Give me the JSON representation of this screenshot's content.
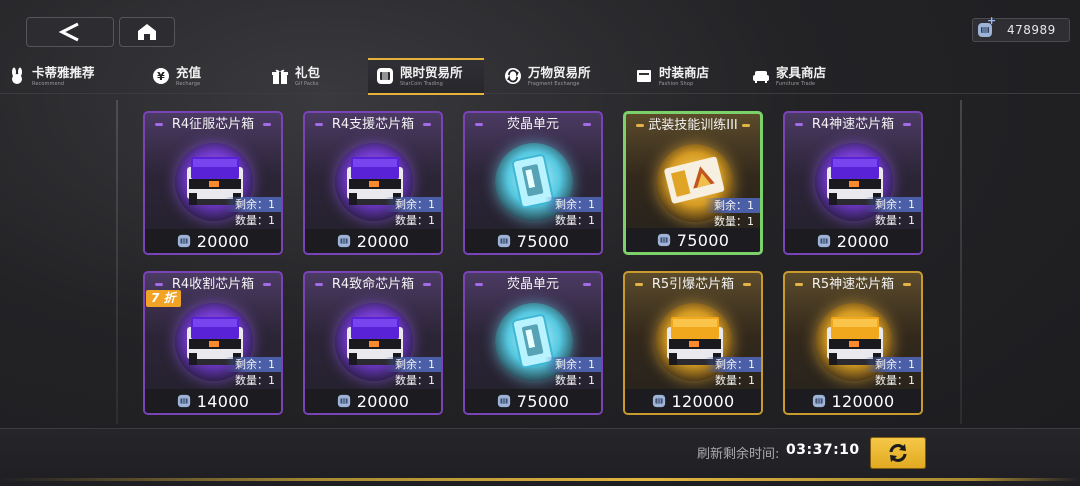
{
  "currency": {
    "amount": "478989"
  },
  "tabs": [
    {
      "label": "卡蒂雅推荐",
      "sub": "Recommend",
      "icon": "bunny-icon"
    },
    {
      "label": "充值",
      "sub": "Recharge",
      "icon": "yen-icon"
    },
    {
      "label": "礼包",
      "sub": "Gif Packs",
      "icon": "gift-icon"
    },
    {
      "label": "限时贸易所",
      "sub": "StarCoin Trading",
      "icon": "trade-icon",
      "active": true
    },
    {
      "label": "万物贸易所",
      "sub": "Fragment Exchange",
      "icon": "exchange-icon"
    },
    {
      "label": "时装商店",
      "sub": "Fashion Shop",
      "icon": "fashion-icon"
    },
    {
      "label": "家具商店",
      "sub": "Furniture Trade",
      "icon": "sofa-icon"
    }
  ],
  "items": [
    {
      "name": "R4征服芯片箱",
      "remain": "剩余：1",
      "qty": "数量：1",
      "price": "20000",
      "rarity": "purple",
      "kind": "chip-box"
    },
    {
      "name": "R4支援芯片箱",
      "remain": "剩余：1",
      "qty": "数量：1",
      "price": "20000",
      "rarity": "purple",
      "kind": "chip-box"
    },
    {
      "name": "荧晶单元",
      "remain": "剩余：1",
      "qty": "数量：1",
      "price": "75000",
      "rarity": "purple",
      "kind": "crystal"
    },
    {
      "name": "武装技能训练III",
      "remain": "剩余：1",
      "qty": "数量：1",
      "price": "75000",
      "rarity": "gold",
      "kind": "ticket",
      "selected": true
    },
    {
      "name": "R4神速芯片箱",
      "remain": "剩余：1",
      "qty": "数量：1",
      "price": "20000",
      "rarity": "purple",
      "kind": "chip-box"
    },
    {
      "name": "R4收割芯片箱",
      "remain": "剩余：1",
      "qty": "数量：1",
      "price": "14000",
      "rarity": "purple",
      "kind": "chip-box",
      "discount": "7 折"
    },
    {
      "name": "R4致命芯片箱",
      "remain": "剩余：1",
      "qty": "数量：1",
      "price": "20000",
      "rarity": "purple",
      "kind": "chip-box"
    },
    {
      "name": "荧晶单元",
      "remain": "剩余：1",
      "qty": "数量：1",
      "price": "75000",
      "rarity": "purple",
      "kind": "crystal"
    },
    {
      "name": "R5引爆芯片箱",
      "remain": "剩余：1",
      "qty": "数量：1",
      "price": "120000",
      "rarity": "gold",
      "kind": "chip-box"
    },
    {
      "name": "R5神速芯片箱",
      "remain": "剩余：1",
      "qty": "数量：1",
      "price": "120000",
      "rarity": "gold",
      "kind": "chip-box"
    }
  ],
  "refresh": {
    "label": "刷新剩余时间:",
    "time": "03:37:10"
  }
}
